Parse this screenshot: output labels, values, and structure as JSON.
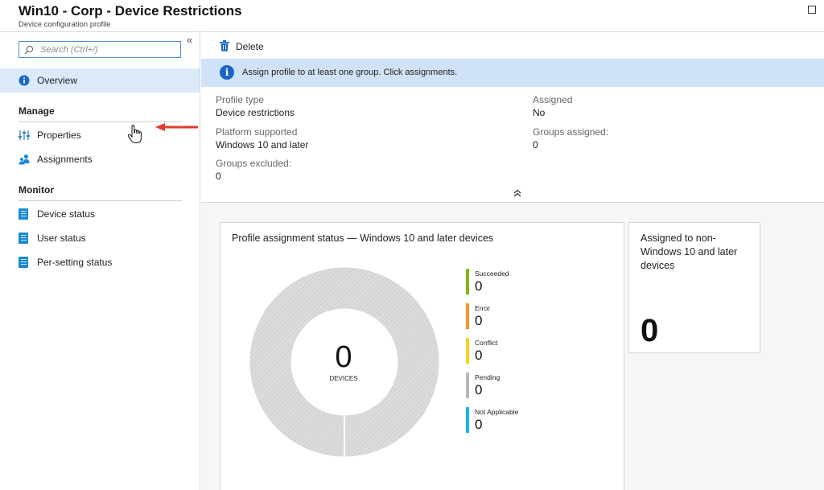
{
  "header": {
    "title": "Win10 - Corp - Device Restrictions",
    "subtitle": "Device configuration profile"
  },
  "sidebar": {
    "search_placeholder": "Search (Ctrl+/)",
    "collapse_glyph": "«",
    "overview_label": "Overview",
    "manage_heading": "Manage",
    "manage_items": [
      {
        "label": "Properties",
        "icon": "sliders-icon"
      },
      {
        "label": "Assignments",
        "icon": "users-icon"
      }
    ],
    "monitor_heading": "Monitor",
    "monitor_items": [
      {
        "label": "Device status",
        "icon": "book-icon"
      },
      {
        "label": "User status",
        "icon": "book-icon"
      },
      {
        "label": "Per-setting status",
        "icon": "book-icon"
      }
    ]
  },
  "toolbar": {
    "delete_label": "Delete"
  },
  "banner": {
    "icon": "info-icon",
    "message": "Assign profile to at least one group. Click assignments."
  },
  "properties": {
    "profile_type_label": "Profile type",
    "profile_type_value": "Device restrictions",
    "platform_label": "Platform supported",
    "platform_value": "Windows 10 and later",
    "groups_excluded_label": "Groups excluded:",
    "groups_excluded_value": "0",
    "assigned_label": "Assigned",
    "assigned_value": "No",
    "groups_assigned_label": "Groups assigned:",
    "groups_assigned_value": "0"
  },
  "status_card": {
    "title": "Profile assignment status — Windows 10 and later devices",
    "total_count": "0",
    "total_label": "DEVICES",
    "legend": [
      {
        "name": "Succeeded",
        "value": "0",
        "color": "#7fba00"
      },
      {
        "name": "Error",
        "value": "0",
        "color": "#f7941d"
      },
      {
        "name": "Conflict",
        "value": "0",
        "color": "#fcd116"
      },
      {
        "name": "Pending",
        "value": "0",
        "color": "#b4b7bb"
      },
      {
        "name": "Not Applicable",
        "value": "0",
        "color": "#1bb5e0"
      }
    ]
  },
  "non_win10_card": {
    "title": "Assigned to non-Windows 10 and later devices",
    "value": "0"
  },
  "colors": {
    "accent": "#1a66c9",
    "active_nav": "#dbe9f8",
    "banner": "#cfe2f8",
    "annotation_arrow": "#e03c31"
  }
}
